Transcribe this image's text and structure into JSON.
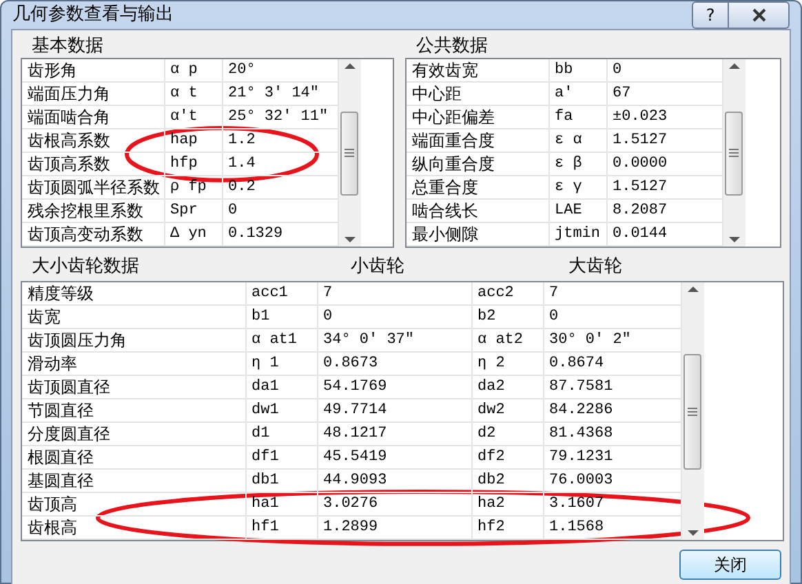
{
  "window": {
    "title": "几何参数查看与输出",
    "help_button": "?"
  },
  "basic": {
    "title": "基本数据",
    "rows": [
      {
        "name": "齿形角",
        "symbol": "α p",
        "value": "20°",
        "circled": false
      },
      {
        "name": "端面压力角",
        "symbol": "α t",
        "value": "21° 3′ 14″",
        "circled": false
      },
      {
        "name": "端面啮合角",
        "symbol": "α′t",
        "value": "25° 32′ 11″",
        "circled": false
      },
      {
        "name": "齿根高系数",
        "symbol": "hap",
        "value": "1.2",
        "circled": true
      },
      {
        "name": "齿顶高系数",
        "symbol": "hfp",
        "value": "1.4",
        "circled": true
      },
      {
        "name": "齿顶圆弧半径系数",
        "symbol": "ρ fp",
        "value": "0.2",
        "circled": false
      },
      {
        "name": "残余挖根里系数",
        "symbol": "Spr",
        "value": "0",
        "circled": false
      },
      {
        "name": "齿顶高变动系数",
        "symbol": "Δ yn",
        "value": "0.1329",
        "circled": false
      }
    ]
  },
  "public": {
    "title": "公共数据",
    "rows": [
      {
        "name": "有效齿宽",
        "symbol": "bb",
        "value": "0",
        "circled": false
      },
      {
        "name": "中心距",
        "symbol": "a′",
        "value": "67",
        "circled": false
      },
      {
        "name": "中心距偏差",
        "symbol": "fa",
        "value": "±0.023",
        "circled": false
      },
      {
        "name": "端面重合度",
        "symbol": "ε α",
        "value": "1.5127",
        "circled": false
      },
      {
        "name": "纵向重合度",
        "symbol": "ε β",
        "value": "0.0000",
        "circled": false
      },
      {
        "name": "总重合度",
        "symbol": "ε γ",
        "value": "1.5127",
        "circled": false
      },
      {
        "name": "啮合线长",
        "symbol": "LAE",
        "value": "8.2087",
        "circled": false
      },
      {
        "name": "最小侧隙",
        "symbol": "jtmin",
        "value": "0.0144",
        "circled": false
      }
    ]
  },
  "gears": {
    "title": "大小齿轮数据",
    "pinion_heading": "小齿轮",
    "wheel_heading": "大齿轮",
    "rows": [
      {
        "name": "精度等级",
        "symbol1": "acc1",
        "value1": "7",
        "symbol2": "acc2",
        "value2": "7",
        "circled": false
      },
      {
        "name": "齿宽",
        "symbol1": "b1",
        "value1": "0",
        "symbol2": "b2",
        "value2": "0",
        "circled": false
      },
      {
        "name": "齿顶圆压力角",
        "symbol1": "α at1",
        "value1": "34° 0′ 37″",
        "symbol2": "α at2",
        "value2": "30° 0′ 2″",
        "circled": false
      },
      {
        "name": "滑动率",
        "symbol1": "η 1",
        "value1": "0.8673",
        "symbol2": "η 2",
        "value2": "0.8674",
        "circled": false
      },
      {
        "name": "齿顶圆直径",
        "symbol1": "da1",
        "value1": "54.1769",
        "symbol2": "da2",
        "value2": "87.7581",
        "circled": false
      },
      {
        "name": "节圆直径",
        "symbol1": "dw1",
        "value1": "49.7714",
        "symbol2": "dw2",
        "value2": "84.2286",
        "circled": false
      },
      {
        "name": "分度圆直径",
        "symbol1": "d1",
        "value1": "48.1217",
        "symbol2": "d2",
        "value2": "81.4368",
        "circled": false
      },
      {
        "name": "根圆直径",
        "symbol1": "df1",
        "value1": "45.5419",
        "symbol2": "df2",
        "value2": "79.1231",
        "circled": false
      },
      {
        "name": "基圆直径",
        "symbol1": "db1",
        "value1": "44.9093",
        "symbol2": "db2",
        "value2": "76.0003",
        "circled": false
      },
      {
        "name": "齿顶高",
        "symbol1": "ha1",
        "value1": "3.0276",
        "symbol2": "ha2",
        "value2": "3.1607",
        "circled": true
      },
      {
        "name": "齿根高",
        "symbol1": "hf1",
        "value1": "1.2899",
        "symbol2": "hf2",
        "value2": "1.1568",
        "circled": true
      }
    ]
  },
  "buttons": [
    "关闭"
  ]
}
